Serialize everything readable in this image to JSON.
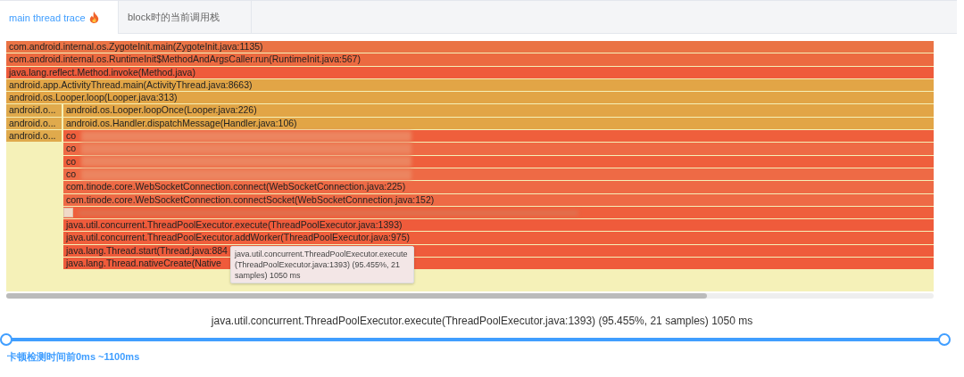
{
  "tabs": [
    {
      "label": "main thread trace",
      "selected": true,
      "fire": true
    },
    {
      "label": "block时的当前调用栈",
      "selected": false,
      "fire": false
    }
  ],
  "flame": {
    "rows": [
      {
        "frames": [
          {
            "kind": "full",
            "label": "com.android.internal.os.ZygoteInit.main(ZygoteInit.java:1135)",
            "color": "#ea7345"
          }
        ]
      },
      {
        "frames": [
          {
            "kind": "full",
            "label": "com.android.internal.os.RuntimeInit$MethodAndArgsCaller.run(RuntimeInit.java:567)",
            "color": "#ec6a40"
          }
        ]
      },
      {
        "frames": [
          {
            "kind": "full",
            "label": "java.lang.reflect.Method.invoke(Method.java)",
            "color": "#ef5b3b"
          }
        ]
      },
      {
        "frames": [
          {
            "kind": "full",
            "label": "android.app.ActivityThread.main(ActivityThread.java:8663)",
            "color": "#e2a546"
          }
        ]
      },
      {
        "frames": [
          {
            "kind": "full",
            "label": "android.os.Looper.loop(Looper.java:313)",
            "color": "#e2a546"
          }
        ]
      },
      {
        "frames": [
          {
            "kind": "side",
            "label": "android.o...",
            "color": "#e0aa4c"
          },
          {
            "kind": "main",
            "label": "android.os.Looper.loopOnce(Looper.java:226)",
            "color": "#e2a546"
          }
        ]
      },
      {
        "frames": [
          {
            "kind": "side",
            "label": "android.o...",
            "color": "#e0aa4c"
          },
          {
            "kind": "main",
            "label": "android.os.Handler.dispatchMessage(Handler.java:106)",
            "color": "#e2a546"
          }
        ]
      },
      {
        "frames": [
          {
            "kind": "side",
            "label": "android.o...",
            "color": "#e0aa4c"
          },
          {
            "kind": "blurred",
            "label": "co",
            "color": "#ef5f3c"
          }
        ]
      },
      {
        "frames": [
          {
            "kind": "blurred",
            "label": "co",
            "color": "#ee6a45"
          }
        ]
      },
      {
        "frames": [
          {
            "kind": "blurred",
            "label": "co",
            "color": "#ef5f3c"
          }
        ]
      },
      {
        "frames": [
          {
            "kind": "blurred",
            "label": "co",
            "color": "#ee6a45"
          }
        ]
      },
      {
        "frames": [
          {
            "kind": "main",
            "label": "com.tinode.core.WebSocketConnection.connect(WebSocketConnection.java:225)",
            "color": "#ee6a45"
          }
        ]
      },
      {
        "frames": [
          {
            "kind": "main",
            "label": "com.tinode.core.WebSocketConnection.connectSocket(WebSocketConnection.java:152)",
            "color": "#ee6a45"
          }
        ]
      },
      {
        "frames": [
          {
            "kind": "masked",
            "color": "#ef5f3c"
          }
        ]
      },
      {
        "frames": [
          {
            "kind": "main",
            "label": "java.util.concurrent.ThreadPoolExecutor.execute(ThreadPoolExecutor.java:1393)",
            "color": "#ef5b3b"
          }
        ]
      },
      {
        "frames": [
          {
            "kind": "main",
            "label": "java.util.concurrent.ThreadPoolExecutor.addWorker(ThreadPoolExecutor.java:975)",
            "color": "#ef5f3c"
          }
        ]
      },
      {
        "frames": [
          {
            "kind": "main",
            "label": "java.lang.Thread.start(Thread.java:884",
            "color": "#ef5b3b"
          }
        ]
      },
      {
        "frames": [
          {
            "kind": "main",
            "label": "java.lang.Thread.nativeCreate(Native",
            "color": "#ef5b3b"
          }
        ]
      }
    ],
    "tooltip": "java.util.concurrent.ThreadPoolExecutor.execute(ThreadPoolExecutor.java:1393) (95.455%, 21 samples) 1050 ms"
  },
  "caption": "java.util.concurrent.ThreadPoolExecutor.execute(ThreadPoolExecutor.java:1393) (95.455%, 21 samples) 1050 ms",
  "range": {
    "handles": [
      {
        "level": 0
      },
      {
        "level": 1
      }
    ],
    "label": "卡顿检测时间前0ms ~1100ms"
  }
}
